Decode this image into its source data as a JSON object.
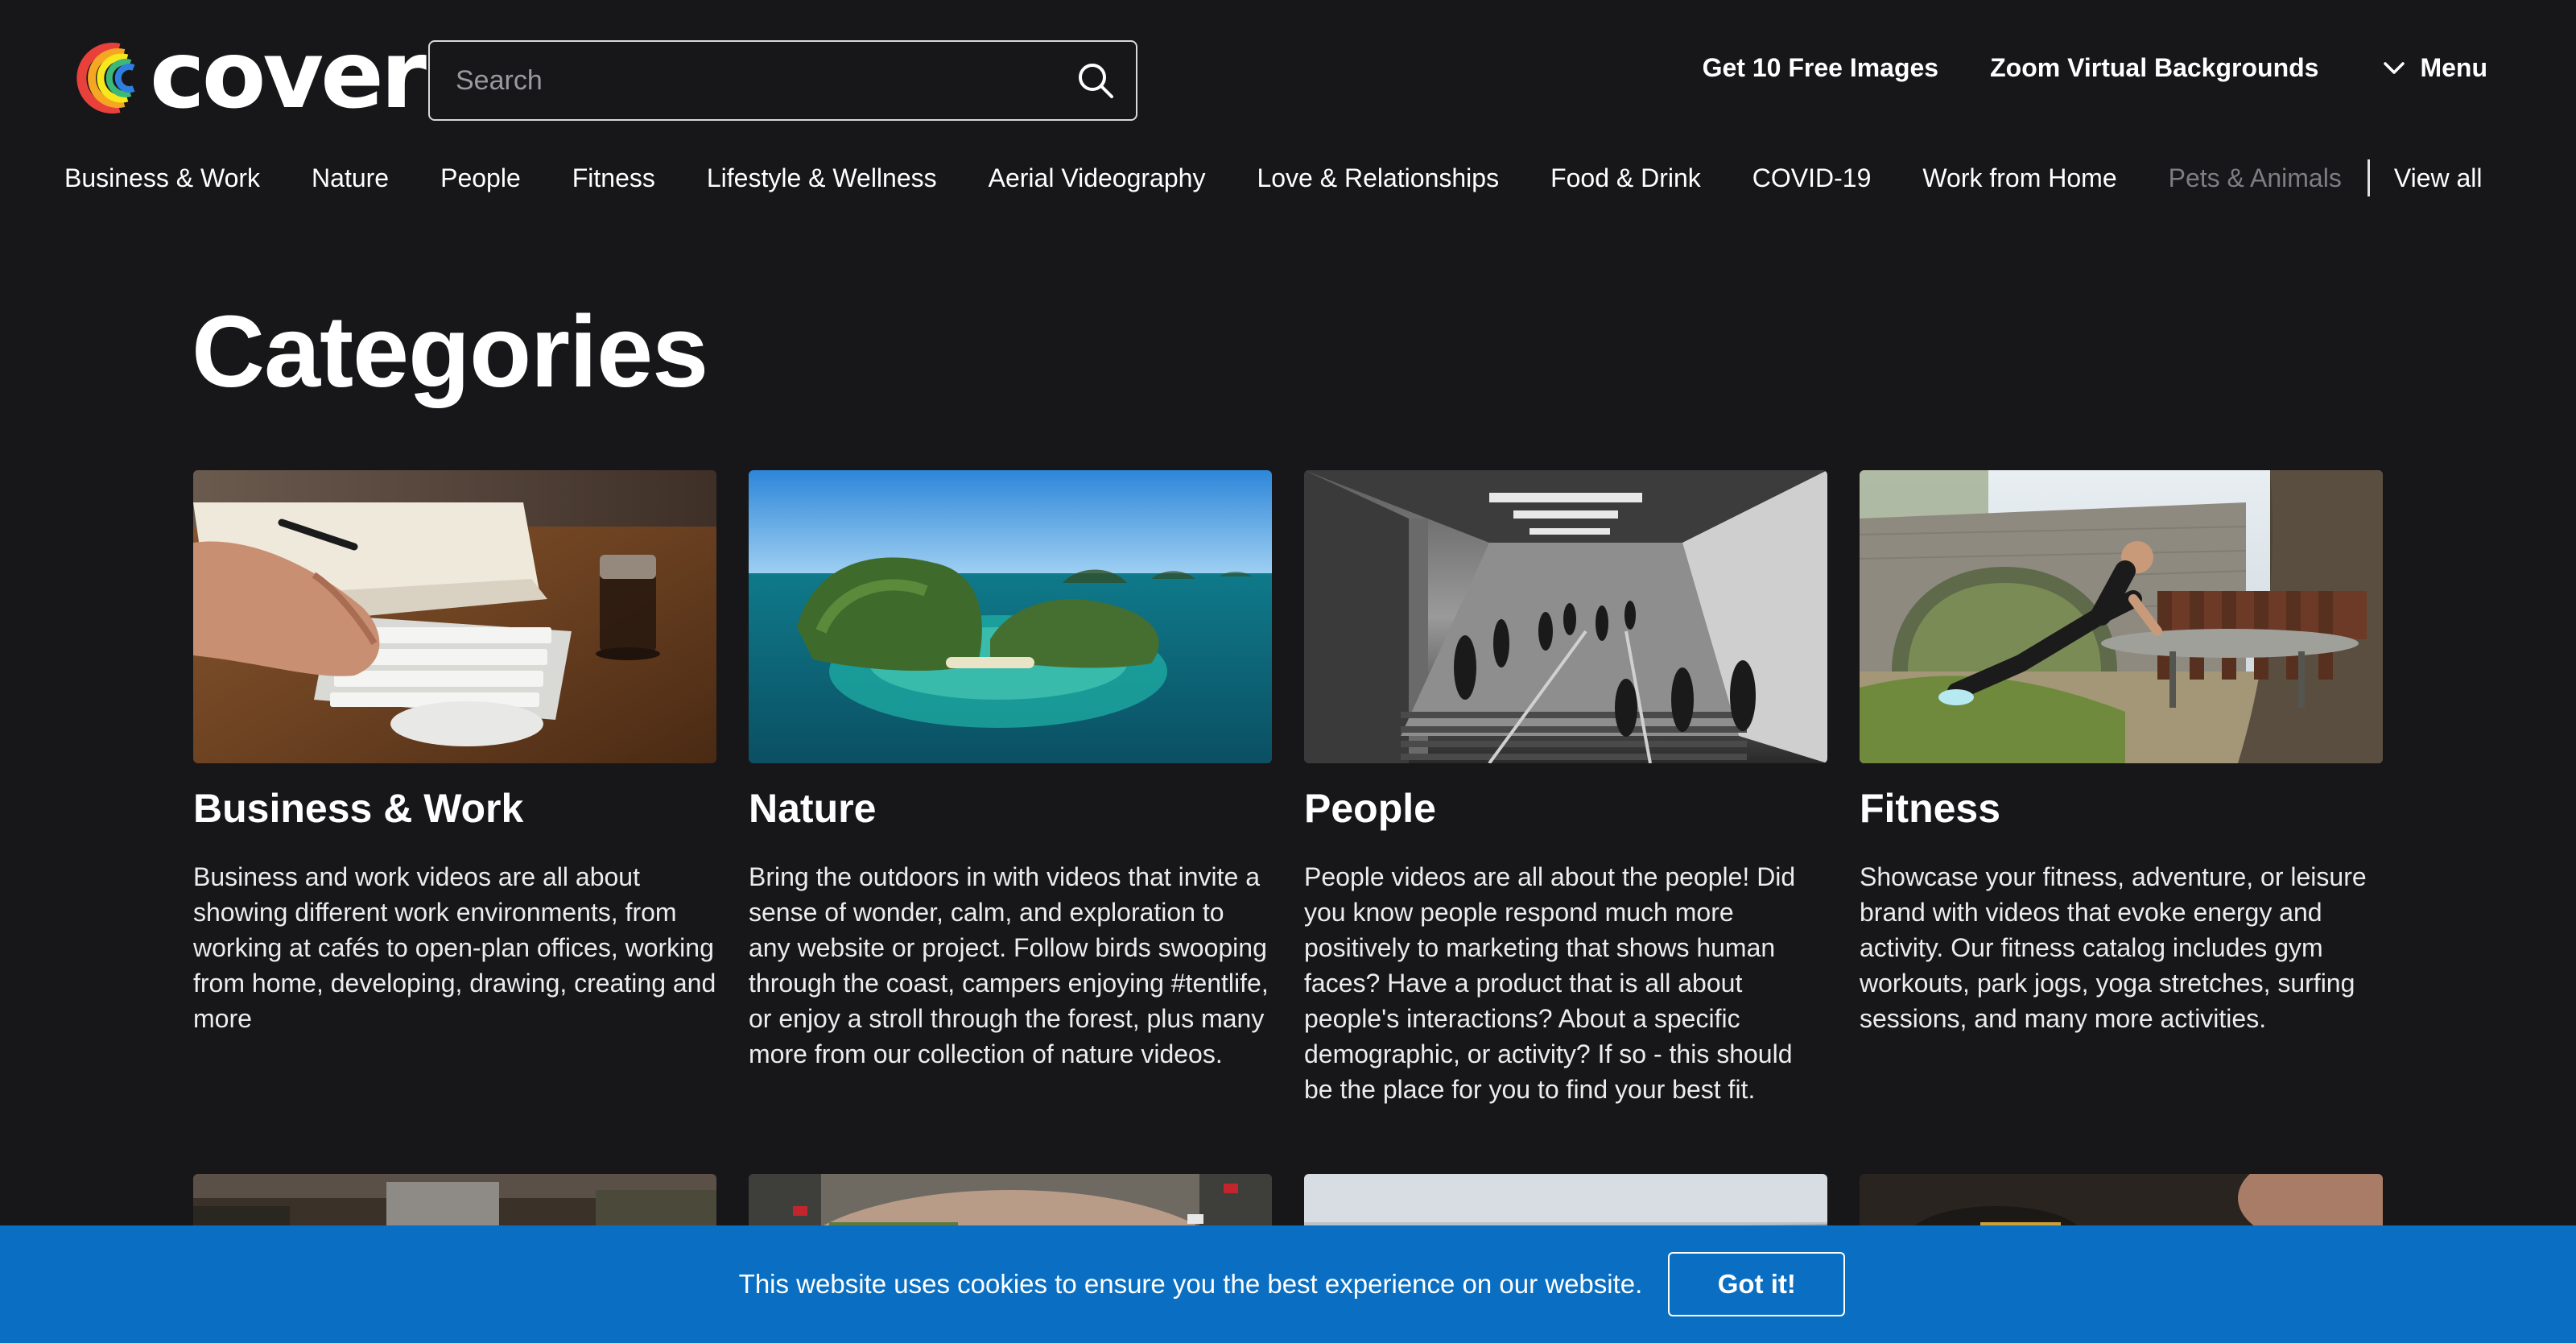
{
  "brand": {
    "logo_text": "coverr"
  },
  "search": {
    "placeholder": "Search"
  },
  "top_links": {
    "free_images": "Get 10 Free Images",
    "zoom_backgrounds": "Zoom Virtual Backgrounds",
    "menu": "Menu"
  },
  "nav": {
    "items": [
      "Business & Work",
      "Nature",
      "People",
      "Fitness",
      "Lifestyle & Wellness",
      "Aerial Videography",
      "Love & Relationships",
      "Food & Drink",
      "COVID-19",
      "Work from Home",
      "Pets & Animals"
    ],
    "view_all": "View all"
  },
  "page": {
    "title": "Categories"
  },
  "categories": [
    {
      "title": "Business & Work",
      "description": "Business and work videos are all about showing different work environments, from working at cafés to open-plan offices, working from home, developing, drawing, creating and more"
    },
    {
      "title": "Nature",
      "description": "Bring the outdoors in with videos that invite a sense of wonder, calm, and exploration to any website or project. Follow birds swooping through the coast, campers enjoying #tentlife, or enjoy a stroll through the forest, plus many more from our collection of nature videos."
    },
    {
      "title": "People",
      "description": "People videos are all about the people! Did you know people respond much more positively to marketing that shows human faces? Have a product that is all about people's interactions? About a specific demographic, or activity? If so - this should be the place for you to find your best fit."
    },
    {
      "title": "Fitness",
      "description": "Showcase your fitness, adventure, or leisure brand with videos that evoke energy and activity. Our fitness catalog includes gym workouts, park jogs, yoga stretches, surfing sessions, and many more activities."
    }
  ],
  "cookie": {
    "message": "This website uses cookies to ensure you the best experience on our website.",
    "button": "Got it!"
  },
  "colors": {
    "background": "#17171a",
    "cookie_banner": "#0a6fc2",
    "text": "#ffffff"
  }
}
